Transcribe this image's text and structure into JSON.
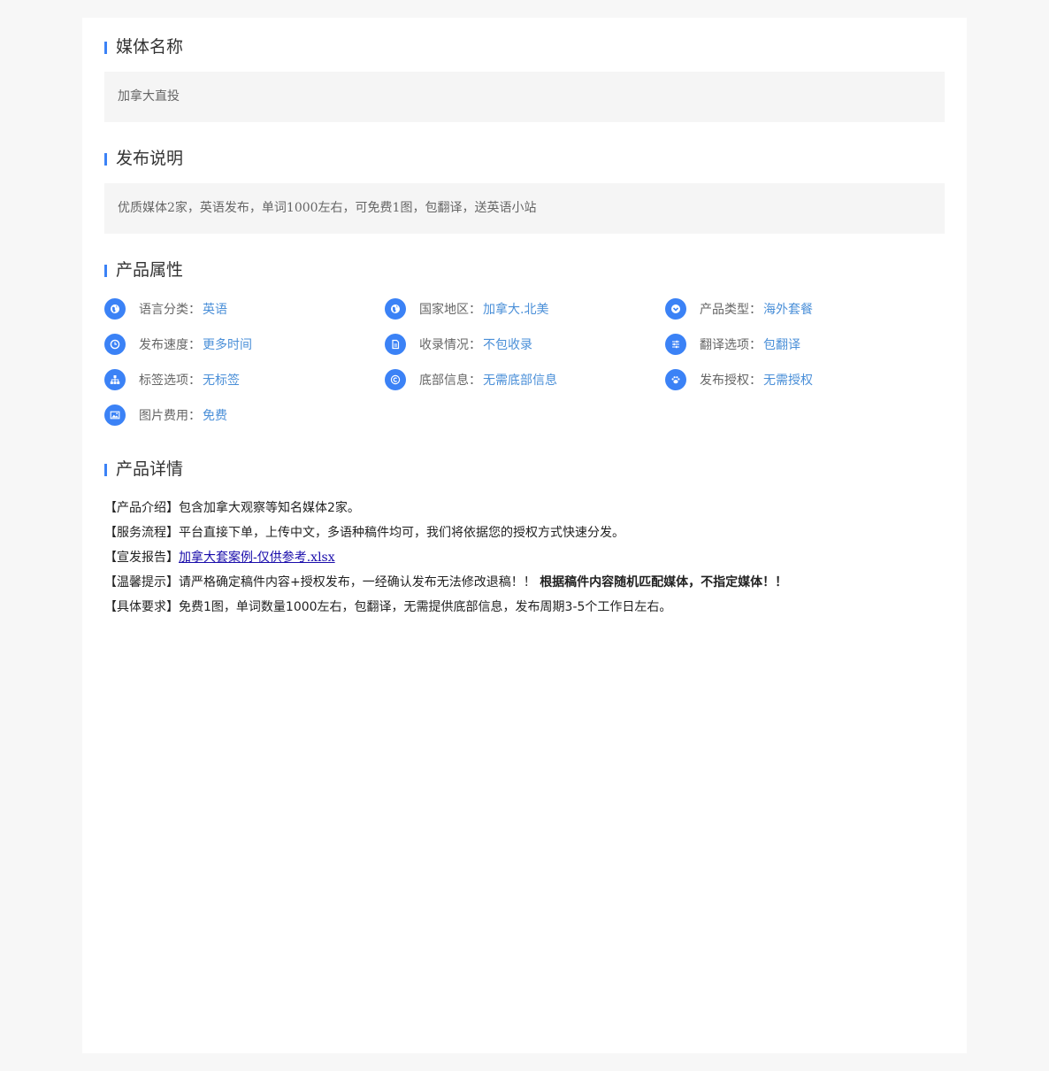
{
  "sections": {
    "media_name": {
      "title": "媒体名称",
      "value": "加拿大直投"
    },
    "publish_note": {
      "title": "发布说明",
      "value": "优质媒体2家，英语发布，单词1000左右，可免费1图，包翻译，送英语小站"
    },
    "attributes": {
      "title": "产品属性",
      "items": [
        {
          "label": "语言分类：",
          "value": "英语",
          "icon": "globe-icon"
        },
        {
          "label": "国家地区：",
          "value": "加拿大.北美",
          "icon": "globe-icon"
        },
        {
          "label": "产品类型：",
          "value": "海外套餐",
          "icon": "chevron-down-icon"
        },
        {
          "label": "发布速度：",
          "value": "更多时间",
          "icon": "clock-icon"
        },
        {
          "label": "收录情况：",
          "value": "不包收录",
          "icon": "document-icon"
        },
        {
          "label": "翻译选项：",
          "value": "包翻译",
          "icon": "sliders-icon"
        },
        {
          "label": "标签选项：",
          "value": "无标签",
          "icon": "sitemap-icon"
        },
        {
          "label": "底部信息：",
          "value": "无需底部信息",
          "icon": "copyright-icon"
        },
        {
          "label": "发布授权：",
          "value": "无需授权",
          "icon": "paw-icon"
        },
        {
          "label": "图片费用：",
          "value": "免费",
          "icon": "image-icon"
        }
      ]
    },
    "details": {
      "title": "产品详情",
      "intro_tag": "【产品介绍】",
      "intro_text": "包含加拿大观察等知名媒体2家。",
      "process_tag": "【服务流程】",
      "process_text": "平台直接下单，上传中文，多语种稿件均可，我们将依据您的授权方式快速分发。",
      "report_tag": "【宣发报告】",
      "report_link": "加拿大套案例-仅供参考.xlsx",
      "tips_tag": "【温馨提示】",
      "tips_text": "请严格确定稿件内容+授权发布，一经确认发布无法修改退稿！！",
      "tips_bold": "根据稿件内容随机匹配媒体，不指定媒体！！",
      "require_tag": "【具体要求】",
      "require_text": "免费1图，单词数量1000左右，包翻译，无需提供底部信息，发布周期3-5个工作日左右。"
    }
  },
  "colors": {
    "accent": "#3b82f6",
    "value_text": "#4a8fd8"
  }
}
